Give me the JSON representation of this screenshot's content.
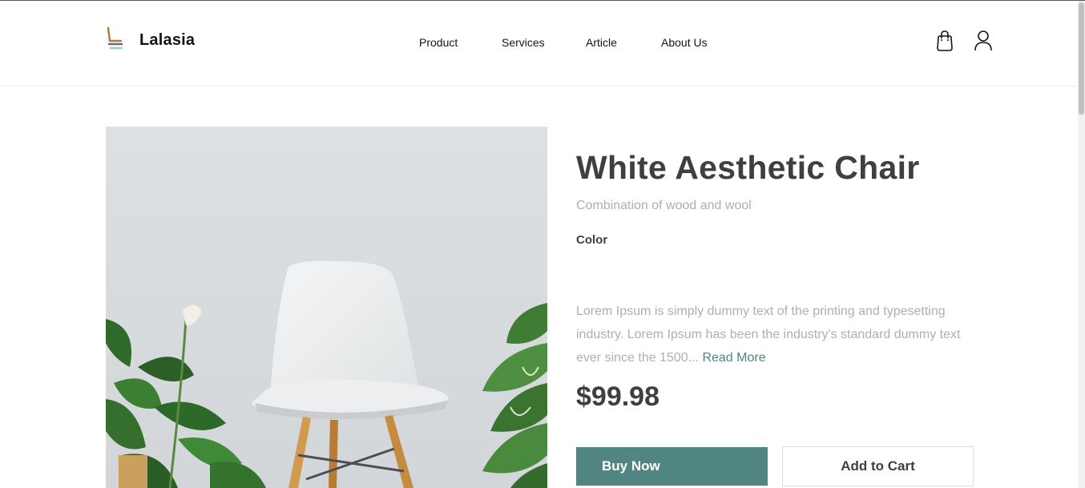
{
  "brand": {
    "name": "Lalasia",
    "logo_colors": {
      "seat": "#a87b4f",
      "base": "#8fd1c4"
    }
  },
  "nav": {
    "items": [
      {
        "label": "Product"
      },
      {
        "label": "Services"
      },
      {
        "label": "Article"
      },
      {
        "label": "About Us"
      }
    ]
  },
  "header_icons": {
    "cart": "shopping-bag-icon",
    "account": "user-icon"
  },
  "product": {
    "image": "white-chair-with-plants-photo",
    "title": "White Aesthetic Chair",
    "subtitle": "Combination of wood and wool",
    "color_label": "Color",
    "description": "Lorem Ipsum is simply dummy text of the printing and typesetting industry. Lorem Ipsum has been the industry's standard dummy text ever since the 1500...",
    "read_more": "Read More",
    "price": "$99.98",
    "buy_label": "Buy Now",
    "cart_label": "Add to Cart"
  },
  "colors": {
    "accent": "#518581",
    "heading": "#3f3f3f",
    "muted": "#afadb5",
    "text": "#151411"
  }
}
